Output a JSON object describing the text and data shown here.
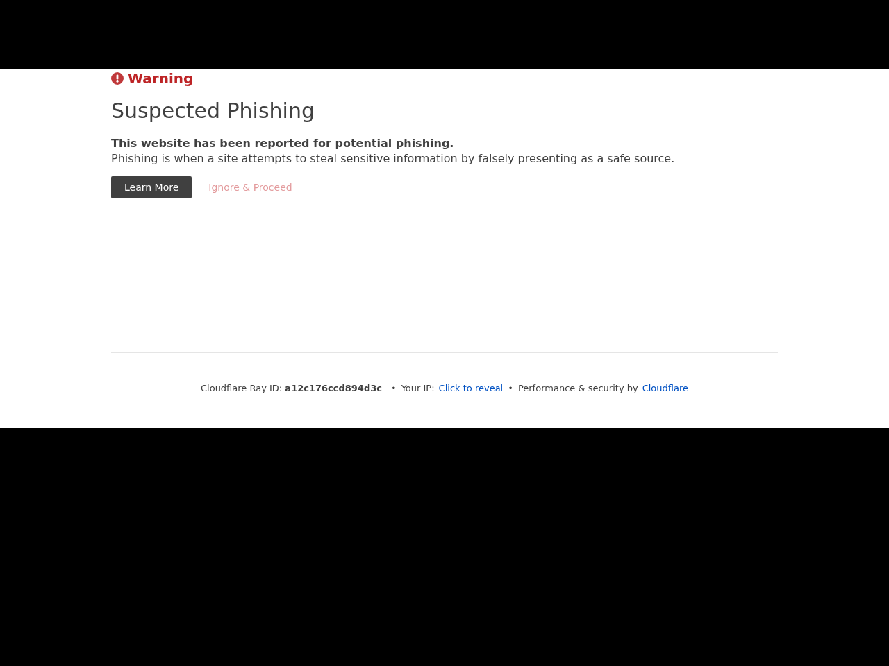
{
  "warning": {
    "label": "Warning"
  },
  "title": "Suspected Phishing",
  "lead": "This website has been reported for potential phishing.",
  "description": "Phishing is when a site attempts to steal sensitive information by falsely presenting as a safe source.",
  "buttons": [
    {
      "kind": "primary",
      "label": "Learn More"
    },
    {
      "kind": "link",
      "label": "Ignore & Proceed"
    }
  ],
  "footer": [
    {
      "kind": "text",
      "text": "Cloudflare Ray ID: **a12c176ccd894d3c**"
    },
    {
      "kind": "separator",
      "text": "•"
    },
    {
      "kind": "text",
      "text": "Your IP:"
    },
    {
      "kind": "link",
      "text": "Click to reveal"
    },
    {
      "kind": "separator",
      "text": "•"
    },
    {
      "kind": "text",
      "text": "Performance & security by"
    },
    {
      "kind": "link",
      "text": "Cloudflare"
    }
  ]
}
